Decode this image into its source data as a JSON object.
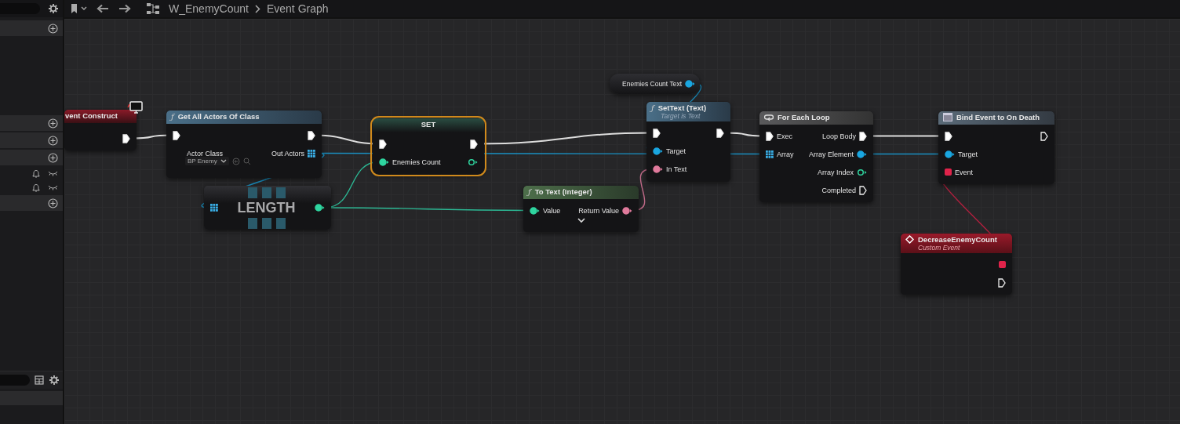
{
  "toolbar": {
    "breadcrumb": [
      {
        "label": "W_EnemyCount"
      },
      {
        "label": "Event Graph"
      }
    ]
  },
  "sidebar": {
    "rows": [
      {
        "kind": "section"
      },
      {
        "kind": "section"
      },
      {
        "kind": "section"
      },
      {
        "kind": "section"
      },
      {
        "kind": "item"
      },
      {
        "kind": "item"
      },
      {
        "kind": "section"
      }
    ]
  },
  "graph": {
    "nodes": [
      {
        "kind": "event",
        "title": "vent Construct",
        "selected": false,
        "outputs": [
          {
            "kind": "exec",
            "connected": true
          }
        ]
      },
      {
        "kind": "function",
        "icon": "ƒ",
        "title": "Get All Actors Of Class",
        "selected": false,
        "inputs": [
          {
            "kind": "exec",
            "connected": true
          },
          {
            "kind": "class",
            "label": "Actor Class",
            "value": "BP Enemy"
          }
        ],
        "outputs": [
          {
            "kind": "exec",
            "connected": true
          },
          {
            "kind": "array",
            "label": "Out Actors",
            "connected": true
          }
        ]
      },
      {
        "kind": "compact",
        "title": "LENGTH",
        "selected": false,
        "inputs": [
          {
            "kind": "array",
            "connected": true
          }
        ],
        "outputs": [
          {
            "kind": "integer",
            "connected": true
          }
        ]
      },
      {
        "kind": "set",
        "title": "SET",
        "selected": true,
        "inputs": [
          {
            "kind": "exec",
            "connected": true
          },
          {
            "kind": "integer",
            "label": "Enemies Count",
            "connected": true
          }
        ],
        "outputs": [
          {
            "kind": "exec",
            "connected": true
          },
          {
            "kind": "integer",
            "connected": false
          }
        ]
      },
      {
        "kind": "variable",
        "selected": false,
        "outputs": [
          {
            "kind": "object",
            "label": "Enemies Count Text",
            "connected": true
          }
        ]
      },
      {
        "kind": "function",
        "icon": "ƒ",
        "title": "SetText (Text)",
        "subtitle": "Target is Text",
        "selected": false,
        "inputs": [
          {
            "kind": "exec",
            "connected": true
          },
          {
            "kind": "object",
            "label": "Target",
            "connected": true
          },
          {
            "kind": "text",
            "label": "In Text",
            "connected": true
          }
        ],
        "outputs": [
          {
            "kind": "exec",
            "connected": true
          }
        ]
      },
      {
        "kind": "pure_function",
        "icon": "ƒ",
        "title": "To Text (Integer)",
        "selected": false,
        "expandable": true,
        "inputs": [
          {
            "kind": "integer",
            "label": "Value",
            "connected": true
          }
        ],
        "outputs": [
          {
            "kind": "text",
            "label": "Return Value",
            "connected": true
          }
        ]
      },
      {
        "kind": "macro",
        "title": "For Each Loop",
        "selected": false,
        "inputs": [
          {
            "kind": "exec",
            "label": "Exec",
            "connected": true
          },
          {
            "kind": "array",
            "label": "Array",
            "connected": true
          }
        ],
        "outputs": [
          {
            "kind": "exec",
            "label": "Loop Body",
            "connected": true
          },
          {
            "kind": "object",
            "label": "Array Element",
            "connected": true
          },
          {
            "kind": "integer",
            "label": "Array Index",
            "connected": false
          },
          {
            "kind": "exec",
            "label": "Completed",
            "connected": false
          }
        ]
      },
      {
        "kind": "bind",
        "title": "Bind Event to On Death",
        "selected": false,
        "inputs": [
          {
            "kind": "exec",
            "connected": true
          },
          {
            "kind": "object",
            "label": "Target",
            "connected": true
          },
          {
            "kind": "delegate",
            "label": "Event",
            "connected": true
          }
        ],
        "outputs": [
          {
            "kind": "exec",
            "connected": false
          }
        ]
      },
      {
        "kind": "custom_event",
        "title": "DecreaseEnemyCount",
        "subtitle": "Custom Event",
        "selected": false,
        "outputs": [
          {
            "kind": "delegate",
            "connected": true
          },
          {
            "kind": "exec",
            "connected": false
          }
        ]
      }
    ]
  }
}
